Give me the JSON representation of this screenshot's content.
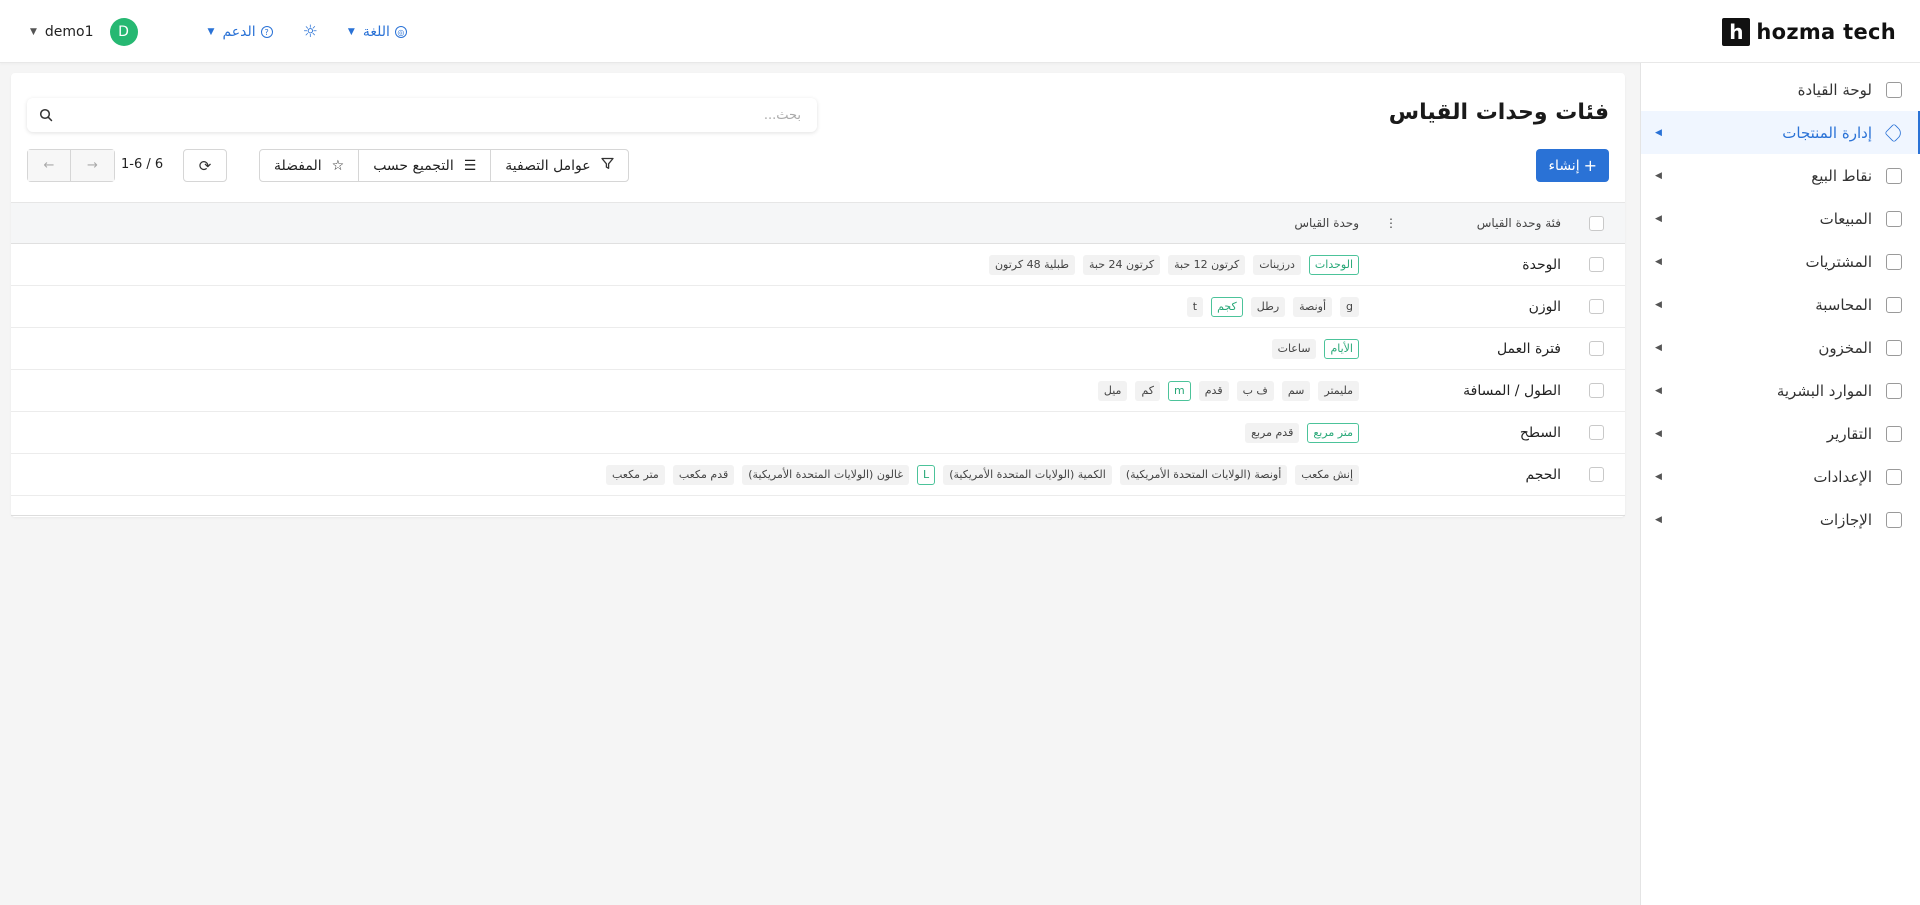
{
  "brand": {
    "logo_letter": "h",
    "name": "hozma tech"
  },
  "topbar": {
    "user_name": "demo1",
    "avatar_letter": "D",
    "support_label": "الدعم",
    "language_label": "اللغة"
  },
  "sidebar": {
    "items": [
      {
        "label": "لوحة القيادة",
        "icon": "dashboard-icon",
        "has_caret": false,
        "active": false
      },
      {
        "label": "إدارة المنتجات",
        "icon": "tag-icon",
        "has_caret": true,
        "active": true
      },
      {
        "label": "نقاط البيع",
        "icon": "store-icon",
        "has_caret": true,
        "active": false
      },
      {
        "label": "المبيعات",
        "icon": "chart-line-icon",
        "has_caret": true,
        "active": false
      },
      {
        "label": "المشتريات",
        "icon": "wallet-icon",
        "has_caret": true,
        "active": false
      },
      {
        "label": "المحاسبة",
        "icon": "ledger-icon",
        "has_caret": true,
        "active": false
      },
      {
        "label": "المخزون",
        "icon": "box-icon",
        "has_caret": true,
        "active": false
      },
      {
        "label": "الموارد البشرية",
        "icon": "document-icon",
        "has_caret": true,
        "active": false
      },
      {
        "label": "التقارير",
        "icon": "report-icon",
        "has_caret": true,
        "active": false
      },
      {
        "label": "الإعدادات",
        "icon": "gear-icon",
        "has_caret": true,
        "active": false
      },
      {
        "label": "الإجازات",
        "icon": "document-icon",
        "has_caret": true,
        "active": false
      }
    ]
  },
  "main": {
    "title": "فئات وحدات القياس",
    "search_placeholder": "بحث...",
    "create_label": "إنشاء",
    "filters_label": "عوامل التصفية",
    "group_by_label": "التجميع حسب",
    "favorites_label": "المفضلة",
    "pager_text": "1-6 / 6"
  },
  "table": {
    "columns": {
      "category": "فئة وحدة القياس",
      "units": "وحدة القياس"
    },
    "rows": [
      {
        "category": "الوحدة",
        "units": [
          {
            "text": "الوحدات",
            "primary": true
          },
          {
            "text": "درزينات",
            "primary": false
          },
          {
            "text": "كرتون 12 حبة",
            "primary": false
          },
          {
            "text": "كرتون 24 حبة",
            "primary": false
          },
          {
            "text": "طبلية 48 كرتون",
            "primary": false
          }
        ]
      },
      {
        "category": "الوزن",
        "units": [
          {
            "text": "g",
            "primary": false
          },
          {
            "text": "أونصة",
            "primary": false
          },
          {
            "text": "رطل",
            "primary": false
          },
          {
            "text": "كجم",
            "primary": true
          },
          {
            "text": "t",
            "primary": false
          }
        ]
      },
      {
        "category": "فترة العمل",
        "units": [
          {
            "text": "الأيام",
            "primary": true
          },
          {
            "text": "ساعات",
            "primary": false
          }
        ]
      },
      {
        "category": "الطول / المسافة",
        "units": [
          {
            "text": "مليمتر",
            "primary": false
          },
          {
            "text": "سم",
            "primary": false
          },
          {
            "text": "ف ب",
            "primary": false
          },
          {
            "text": "قدم",
            "primary": false
          },
          {
            "text": "m",
            "primary": true
          },
          {
            "text": "كم",
            "primary": false
          },
          {
            "text": "ميل",
            "primary": false
          }
        ]
      },
      {
        "category": "السطح",
        "units": [
          {
            "text": "متر مربع",
            "primary": true
          },
          {
            "text": "قدم مربع",
            "primary": false
          }
        ]
      },
      {
        "category": "الحجم",
        "units": [
          {
            "text": "إنش مكعب",
            "primary": false
          },
          {
            "text": "أونصة (الولايات المتحدة الأمريكية)",
            "primary": false
          },
          {
            "text": "الكمية (الولايات المتحدة الأمريكية)",
            "primary": false
          },
          {
            "text": "L",
            "primary": true
          },
          {
            "text": "غالون (الولايات المتحدة الأمريكية)",
            "primary": false
          },
          {
            "text": "قدم مكعب",
            "primary": false
          },
          {
            "text": "متر مكعب",
            "primary": false
          }
        ]
      }
    ]
  },
  "colors": {
    "accent": "#2a72d6",
    "success": "#26b872",
    "tag_primary": "#4cc39a"
  }
}
